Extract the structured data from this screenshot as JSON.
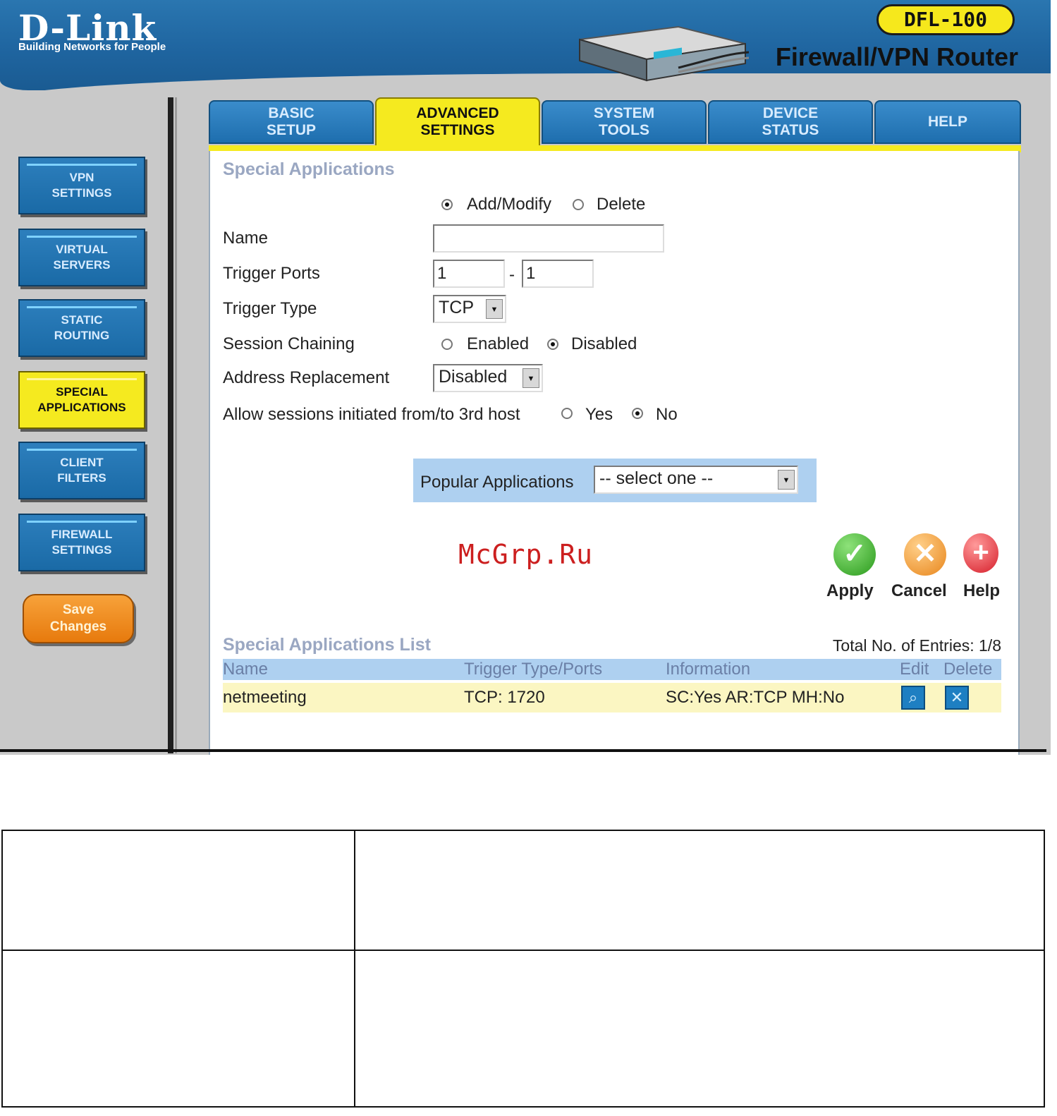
{
  "header": {
    "brand": "D-Link",
    "tagline": "Building Networks for People",
    "model": "DFL-100",
    "product": "Firewall/VPN Router"
  },
  "tabs": [
    {
      "label": "BASIC\nSETUP",
      "active": false
    },
    {
      "label": "ADVANCED\nSETTINGS",
      "active": true
    },
    {
      "label": "SYSTEM\nTOOLS",
      "active": false
    },
    {
      "label": "DEVICE\nSTATUS",
      "active": false
    },
    {
      "label": "HELP",
      "active": false
    }
  ],
  "sidebar": {
    "items": [
      {
        "label": "VPN\nSETTINGS",
        "active": false
      },
      {
        "label": "VIRTUAL\nSERVERS",
        "active": false
      },
      {
        "label": "STATIC\nROUTING",
        "active": false
      },
      {
        "label": "SPECIAL\nAPPLICATIONS",
        "active": true
      },
      {
        "label": "CLIENT\nFILTERS",
        "active": false
      },
      {
        "label": "FIREWALL\nSETTINGS",
        "active": false
      }
    ],
    "save_label": "Save\nChanges"
  },
  "form": {
    "title": "Special Applications",
    "mode_add": "Add/Modify",
    "mode_delete": "Delete",
    "mode_selected": "Add/Modify",
    "name_label": "Name",
    "name_value": "",
    "trigger_ports_label": "Trigger Ports",
    "trigger_port_start": "1",
    "port_separator": "-",
    "trigger_port_end": "1",
    "trigger_type_label": "Trigger Type",
    "trigger_type_value": "TCP",
    "session_chaining_label": "Session Chaining",
    "session_enabled": "Enabled",
    "session_disabled": "Disabled",
    "session_selected": "Disabled",
    "address_replacement_label": "Address Replacement",
    "address_replacement_value": "Disabled",
    "third_host_label": "Allow sessions initiated from/to 3rd host",
    "third_host_yes": "Yes",
    "third_host_no": "No",
    "third_host_selected": "No",
    "popular_label": "Popular Applications",
    "popular_value": "-- select one --"
  },
  "actions": {
    "apply": "Apply",
    "cancel": "Cancel",
    "help": "Help"
  },
  "list": {
    "title": "Special Applications List",
    "total_label": "Total No. of Entries: 1/8",
    "columns": [
      "Name",
      "Trigger Type/Ports",
      "Information",
      "Edit",
      "Delete"
    ],
    "rows": [
      {
        "name": "netmeeting",
        "trigger": "TCP:  1720",
        "info": "SC:Yes  AR:TCP  MH:No"
      }
    ]
  },
  "watermark": "McGrp.Ru",
  "icons": {
    "apply": "check-icon",
    "cancel": "x-icon",
    "help": "plus-icon",
    "edit": "magnifier-icon",
    "delete": "x-icon"
  },
  "colors": {
    "accent_blue": "#1e6eae",
    "active_yellow": "#f5ea1f",
    "save_orange": "#e77a0d",
    "apply_green": "#2a9a1c",
    "cancel_orange": "#e8861c",
    "help_red": "#d61f2b"
  }
}
